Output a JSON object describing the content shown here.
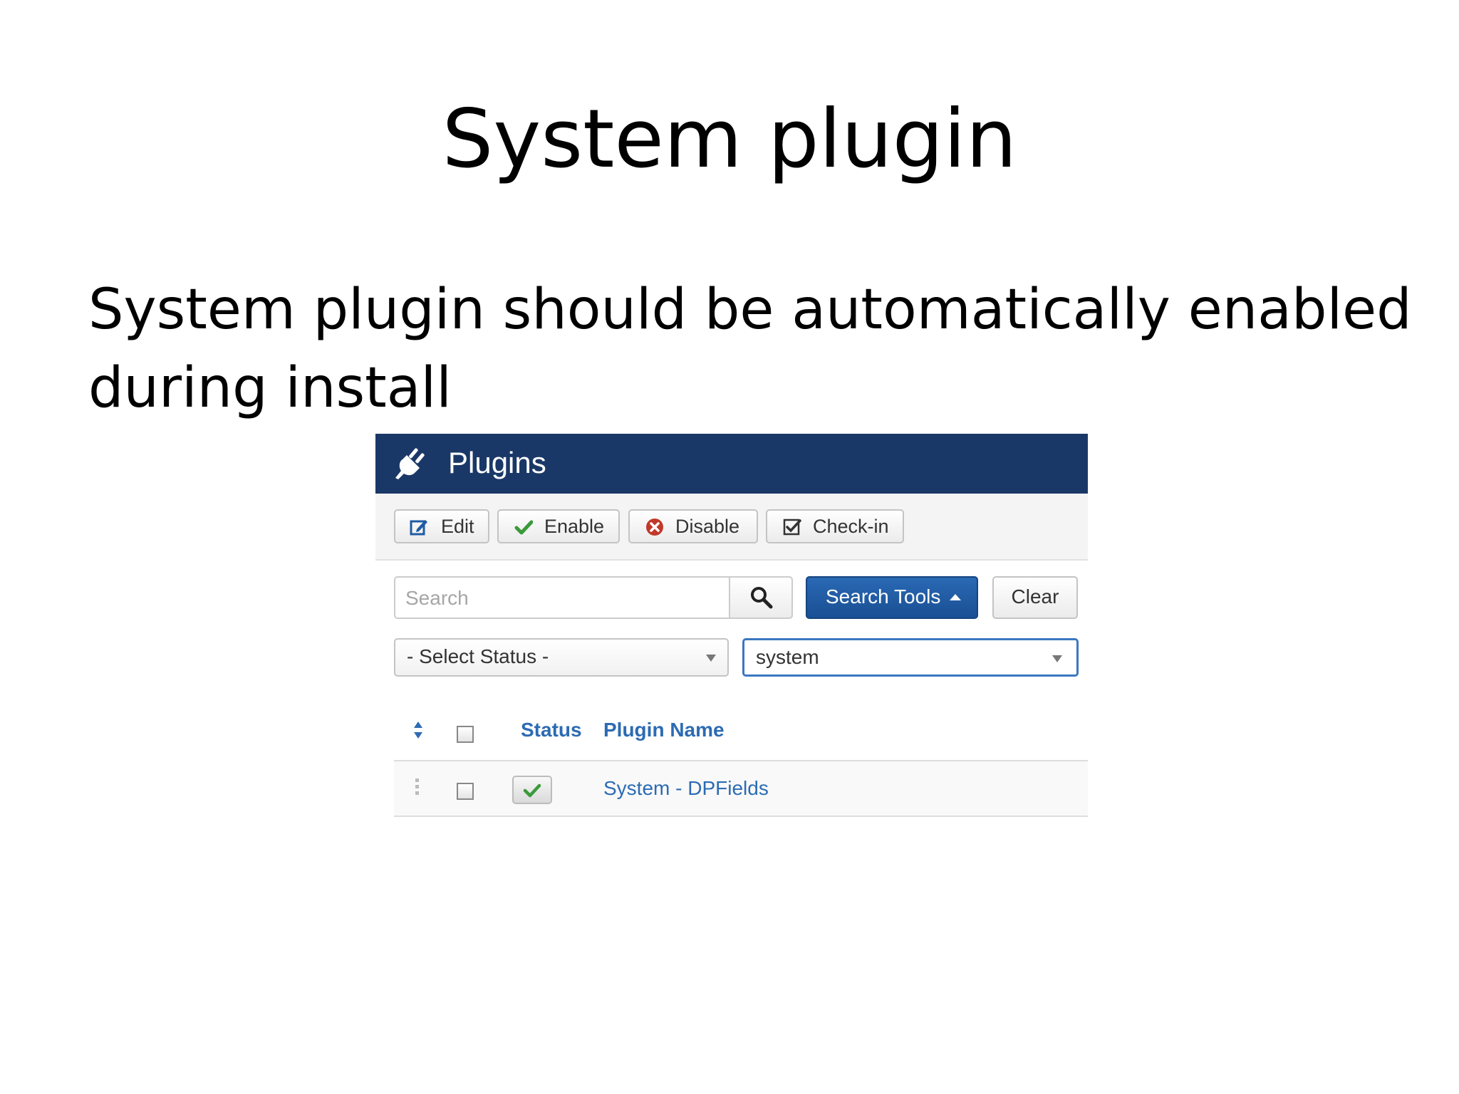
{
  "slide": {
    "title": "System plugin",
    "body": "System plugin should be automatically enabled during install"
  },
  "header": {
    "title": "Plugins",
    "icon": "plug-icon"
  },
  "toolbar": {
    "edit_label": "Edit",
    "enable_label": "Enable",
    "disable_label": "Disable",
    "checkin_label": "Check-in"
  },
  "filters": {
    "search_placeholder": "Search",
    "search_tools_label": "Search Tools",
    "clear_label": "Clear",
    "status_select_value": "- Select Status -",
    "folder_select_value": "system"
  },
  "table": {
    "columns": [
      "Status",
      "Plugin Name"
    ],
    "rows": [
      {
        "status": "enabled",
        "name": "System - DPFields"
      }
    ]
  },
  "colors": {
    "header_bg": "#1a3867",
    "primary_button": "#1f5ba4",
    "link": "#2d6bb3",
    "enabled_check": "#3a9a3a",
    "disable_icon": "#c0392b"
  }
}
